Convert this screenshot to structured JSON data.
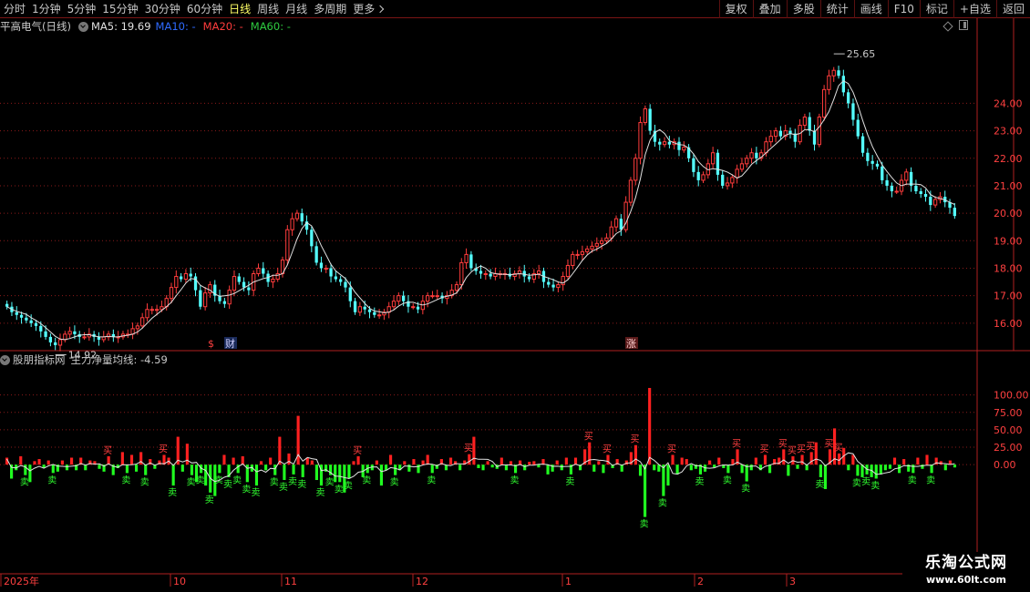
{
  "toolbar": {
    "tabs": [
      "分时",
      "1分钟",
      "5分钟",
      "15分钟",
      "30分钟",
      "60分钟",
      "日线",
      "周线",
      "月线",
      "多周期"
    ],
    "active_tab": "日线",
    "more_label": "更多",
    "right_buttons": [
      "复权",
      "叠加",
      "多股",
      "统计",
      "画线",
      "F10",
      "标记",
      "+自选",
      "返回"
    ]
  },
  "info": {
    "stock_name": "平高电气(日线)",
    "ma5": "MA5: 19.69",
    "ma10": "MA10: -",
    "ma20": "MA20: -",
    "ma60": "MA60: -"
  },
  "indicator": {
    "name": "股朋指标网",
    "line_label": "主力净量均线: -4.59"
  },
  "colors": {
    "up": "#ff3c3c",
    "down": "#54ffff",
    "ma5": "#e0e0e0",
    "ma10": "#2f6bff",
    "ma20": "#ff3c3c",
    "ma60": "#2ecc40",
    "bar_pos": "#ff2020",
    "bar_neg": "#20ff20",
    "grid": "#8a1a1a"
  },
  "watermark": {
    "line1": "乐淘公式网",
    "line2": "www.60lt.com"
  },
  "chart_data": [
    {
      "type": "candlestick",
      "ylim": [
        15.0,
        26.5
      ],
      "yticks": [
        16.0,
        17.0,
        18.0,
        19.0,
        20.0,
        21.0,
        22.0,
        23.0,
        24.0
      ],
      "ytick_labels": [
        "16.00",
        "17.00",
        "18.00",
        "19.00",
        "20.00",
        "21.00",
        "22.00",
        "23.00",
        "24.00"
      ],
      "x_month_labels": [
        "2025年",
        "10",
        "11",
        "12",
        "1",
        "2",
        "3"
      ],
      "annotations": {
        "low": "14.92",
        "high": "25.65",
        "marker_s": "$",
        "marker_cai": "财",
        "marker_zhang": "涨"
      },
      "close": [
        16.6,
        16.4,
        16.3,
        16.2,
        16.1,
        16.0,
        15.9,
        15.7,
        15.5,
        15.3,
        15.2,
        15.4,
        15.6,
        15.7,
        15.6,
        15.5,
        15.5,
        15.6,
        15.5,
        15.4,
        15.5,
        15.6,
        15.5,
        15.5,
        15.6,
        15.6,
        15.8,
        15.9,
        16.2,
        16.5,
        16.5,
        16.5,
        16.6,
        16.9,
        17.3,
        17.7,
        17.6,
        17.8,
        17.7,
        17.2,
        16.6,
        17.1,
        17.4,
        17.0,
        16.8,
        16.7,
        17.2,
        17.7,
        17.5,
        17.3,
        17.2,
        17.8,
        18.0,
        17.8,
        17.5,
        17.6,
        17.8,
        18.3,
        19.4,
        19.8,
        20.0,
        19.7,
        19.4,
        18.8,
        18.2,
        18.0,
        18.0,
        17.7,
        17.6,
        17.5,
        17.3,
        16.8,
        16.4,
        16.6,
        16.5,
        16.4,
        16.3,
        16.3,
        16.4,
        16.6,
        16.8,
        17.0,
        16.8,
        16.6,
        16.6,
        16.5,
        16.8,
        17.0,
        17.0,
        17.0,
        16.9,
        17.0,
        17.2,
        17.4,
        18.2,
        18.5,
        18.0,
        17.9,
        17.8,
        17.8,
        17.7,
        17.8,
        17.8,
        17.8,
        17.7,
        17.8,
        17.9,
        17.7,
        17.6,
        17.8,
        17.9,
        17.5,
        17.4,
        17.3,
        17.4,
        17.7,
        18.1,
        18.5,
        18.5,
        18.6,
        18.7,
        18.8,
        18.9,
        19.0,
        19.1,
        19.5,
        19.8,
        19.4,
        20.4,
        21.2,
        22.0,
        23.3,
        23.8,
        23.0,
        22.6,
        22.5,
        22.6,
        22.5,
        22.6,
        22.3,
        22.4,
        22.0,
        21.5,
        21.2,
        21.4,
        21.8,
        22.2,
        21.4,
        21.0,
        21.1,
        21.3,
        21.6,
        21.8,
        22.0,
        22.2,
        22.0,
        22.2,
        22.6,
        22.8,
        23.0,
        22.8,
        23.0,
        22.9,
        22.6,
        23.2,
        23.5,
        23.0,
        22.5,
        23.5,
        24.5,
        25.0,
        25.2,
        25.0,
        24.4,
        24.0,
        23.4,
        22.8,
        22.2,
        21.9,
        21.8,
        21.7,
        21.2,
        21.0,
        20.8,
        20.8,
        21.2,
        21.5,
        21.0,
        20.8,
        20.7,
        20.6,
        20.3,
        20.5,
        20.6,
        20.4,
        20.2,
        19.9
      ],
      "open": [
        16.7,
        16.6,
        16.4,
        16.3,
        16.2,
        16.1,
        16.0,
        15.9,
        15.7,
        15.5,
        15.3,
        15.2,
        15.4,
        15.6,
        15.7,
        15.6,
        15.5,
        15.5,
        15.6,
        15.5,
        15.4,
        15.5,
        15.6,
        15.5,
        15.5,
        15.6,
        15.6,
        15.8,
        15.9,
        16.2,
        16.5,
        16.5,
        16.5,
        16.6,
        16.9,
        17.3,
        17.7,
        17.6,
        17.8,
        17.7,
        17.2,
        16.6,
        17.1,
        17.4,
        17.0,
        16.8,
        16.7,
        17.2,
        17.7,
        17.5,
        17.3,
        17.2,
        17.8,
        18.0,
        17.8,
        17.5,
        17.6,
        17.8,
        18.3,
        19.4,
        19.8,
        20.0,
        19.7,
        19.4,
        18.8,
        18.2,
        18.0,
        18.0,
        17.7,
        17.6,
        17.5,
        17.3,
        16.8,
        16.4,
        16.6,
        16.5,
        16.4,
        16.3,
        16.3,
        16.4,
        16.6,
        16.8,
        17.0,
        16.8,
        16.6,
        16.6,
        16.5,
        16.8,
        17.0,
        17.0,
        17.0,
        16.9,
        17.0,
        17.2,
        17.4,
        18.2,
        18.5,
        18.0,
        17.9,
        17.8,
        17.8,
        17.7,
        17.8,
        17.8,
        17.8,
        17.7,
        17.8,
        17.9,
        17.7,
        17.6,
        17.8,
        17.9,
        17.5,
        17.4,
        17.3,
        17.4,
        17.7,
        18.1,
        18.5,
        18.5,
        18.6,
        18.7,
        18.8,
        18.9,
        19.0,
        19.1,
        19.5,
        19.8,
        19.4,
        20.4,
        21.2,
        22.0,
        23.3,
        23.8,
        23.0,
        22.6,
        22.5,
        22.6,
        22.5,
        22.6,
        22.3,
        22.4,
        22.0,
        21.5,
        21.2,
        21.4,
        21.8,
        22.2,
        21.4,
        21.0,
        21.1,
        21.3,
        21.6,
        21.8,
        22.0,
        22.2,
        22.0,
        22.2,
        22.6,
        22.8,
        23.0,
        22.8,
        23.0,
        22.9,
        22.6,
        23.2,
        23.5,
        23.0,
        22.5,
        23.5,
        24.5,
        25.0,
        25.2,
        25.0,
        24.4,
        24.0,
        23.4,
        22.8,
        22.2,
        21.9,
        21.8,
        21.7,
        21.2,
        21.0,
        20.8,
        20.8,
        21.2,
        21.5,
        21.0,
        20.8,
        20.7,
        20.6,
        20.3,
        20.5,
        20.6,
        20.4,
        20.2
      ]
    },
    {
      "type": "bar",
      "series_label": "主力净量均线",
      "ylim": [
        -150,
        140
      ],
      "yticks": [
        0,
        25,
        50,
        75,
        100
      ],
      "ytick_labels": [
        "0.00",
        "25.00",
        "50.00",
        "75.00",
        "100.00"
      ],
      "buy_label": "买",
      "sell_label": "卖",
      "values": [
        10,
        -20,
        -8,
        12,
        -15,
        -25,
        5,
        8,
        -5,
        6,
        -12,
        -10,
        6,
        -8,
        10,
        -8,
        10,
        -8,
        6,
        5,
        -6,
        -10,
        12,
        -15,
        -5,
        18,
        -12,
        14,
        -10,
        18,
        -15,
        8,
        -6,
        6,
        14,
        10,
        -30,
        40,
        -10,
        30,
        -15,
        -25,
        -12,
        -30,
        -40,
        -45,
        -12,
        14,
        -18,
        10,
        -12,
        12,
        -25,
        -10,
        -30,
        5,
        -8,
        10,
        -15,
        40,
        -22,
        16,
        -14,
        70,
        -18,
        10,
        6,
        -22,
        -30,
        -10,
        -15,
        -25,
        -25,
        -40,
        -20,
        5,
        12,
        -18,
        -12,
        -8,
        6,
        -30,
        -8,
        14,
        -15,
        -8,
        5,
        -10,
        8,
        -12,
        6,
        14,
        -12,
        -6,
        8,
        -8,
        10,
        5,
        -8,
        6,
        15,
        40,
        -5,
        -8,
        5,
        -4,
        -6,
        10,
        -8,
        5,
        -12,
        6,
        -8,
        4,
        5,
        -4,
        8,
        -14,
        -10,
        6,
        -8,
        10,
        -14,
        10,
        -8,
        22,
        32,
        -10,
        5,
        -12,
        14,
        -5,
        8,
        -10,
        6,
        18,
        28,
        -16,
        -75,
        110,
        -8,
        -10,
        -45,
        -30,
        14,
        -14,
        10,
        8,
        -8,
        -6,
        -14,
        -10,
        6,
        -4,
        10,
        -5,
        -12,
        8,
        22,
        -12,
        -24,
        -8,
        10,
        -8,
        14,
        -12,
        8,
        10,
        22,
        -16,
        12,
        -6,
        14,
        -8,
        18,
        32,
        -18,
        -35,
        22,
        52,
        16,
        24,
        -8,
        14,
        -16,
        -18,
        -14,
        -18,
        -20,
        -14,
        -8,
        -6,
        10,
        -12,
        8,
        -10,
        -12,
        10,
        -6,
        14,
        -12,
        10,
        5,
        -8,
        6,
        -4
      ]
    }
  ]
}
